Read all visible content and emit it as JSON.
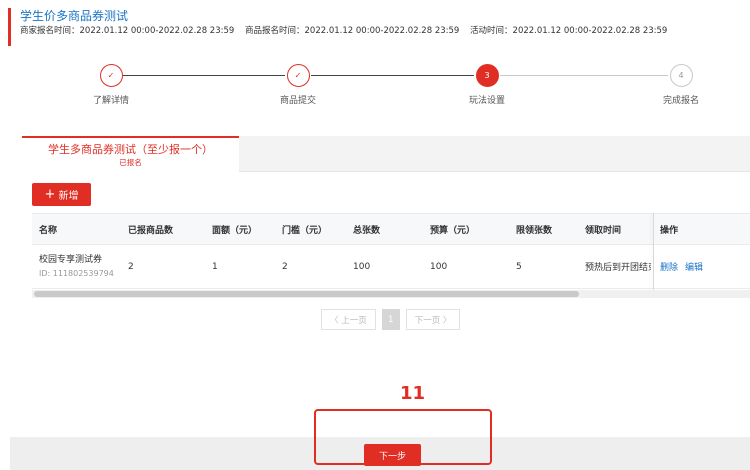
{
  "header": {
    "title": "学生价多商品券测试",
    "merchant_time": "商家报名时间：2022.01.12 00:00-2022.02.28 23:59",
    "product_time": "商品报名时间：2022.01.12 00:00-2022.02.28 23:59",
    "activity_time": "活动时间：2022.01.12 00:00-2022.02.28 23:59"
  },
  "steps": [
    {
      "num": "✓",
      "label": "了解详情",
      "state": "done"
    },
    {
      "num": "✓",
      "label": "商品提交",
      "state": "done"
    },
    {
      "num": "3",
      "label": "玩法设置",
      "state": "active"
    },
    {
      "num": "4",
      "label": "完成报名",
      "state": "todo"
    }
  ],
  "tab": {
    "title": "学生多商品券测试（至少报一个）",
    "status": "已报名"
  },
  "add_button": {
    "icon": "plus-icon",
    "label": "新增"
  },
  "table": {
    "headers": [
      "名称",
      "已报商品数",
      "面额（元）",
      "门槛（元）",
      "总张数",
      "预算（元）",
      "限领张数",
      "领取时间",
      "操作"
    ],
    "rows": [
      {
        "name": "校园专享测试券",
        "id": "ID: 111802539794",
        "count": "2",
        "face": "1",
        "threshold": "2",
        "total": "100",
        "budget": "100",
        "limit": "5",
        "receive_time": "预热后到开团结束",
        "delete": "删除",
        "edit": "编辑"
      }
    ]
  },
  "pager": {
    "prev": "〈 上一页",
    "page": "1",
    "next": "下一页 〉"
  },
  "annotation": {
    "number": "11"
  },
  "footer": {
    "next_label": "下一步"
  },
  "colors": {
    "accent": "#e02e24",
    "link": "#1a73c7"
  }
}
